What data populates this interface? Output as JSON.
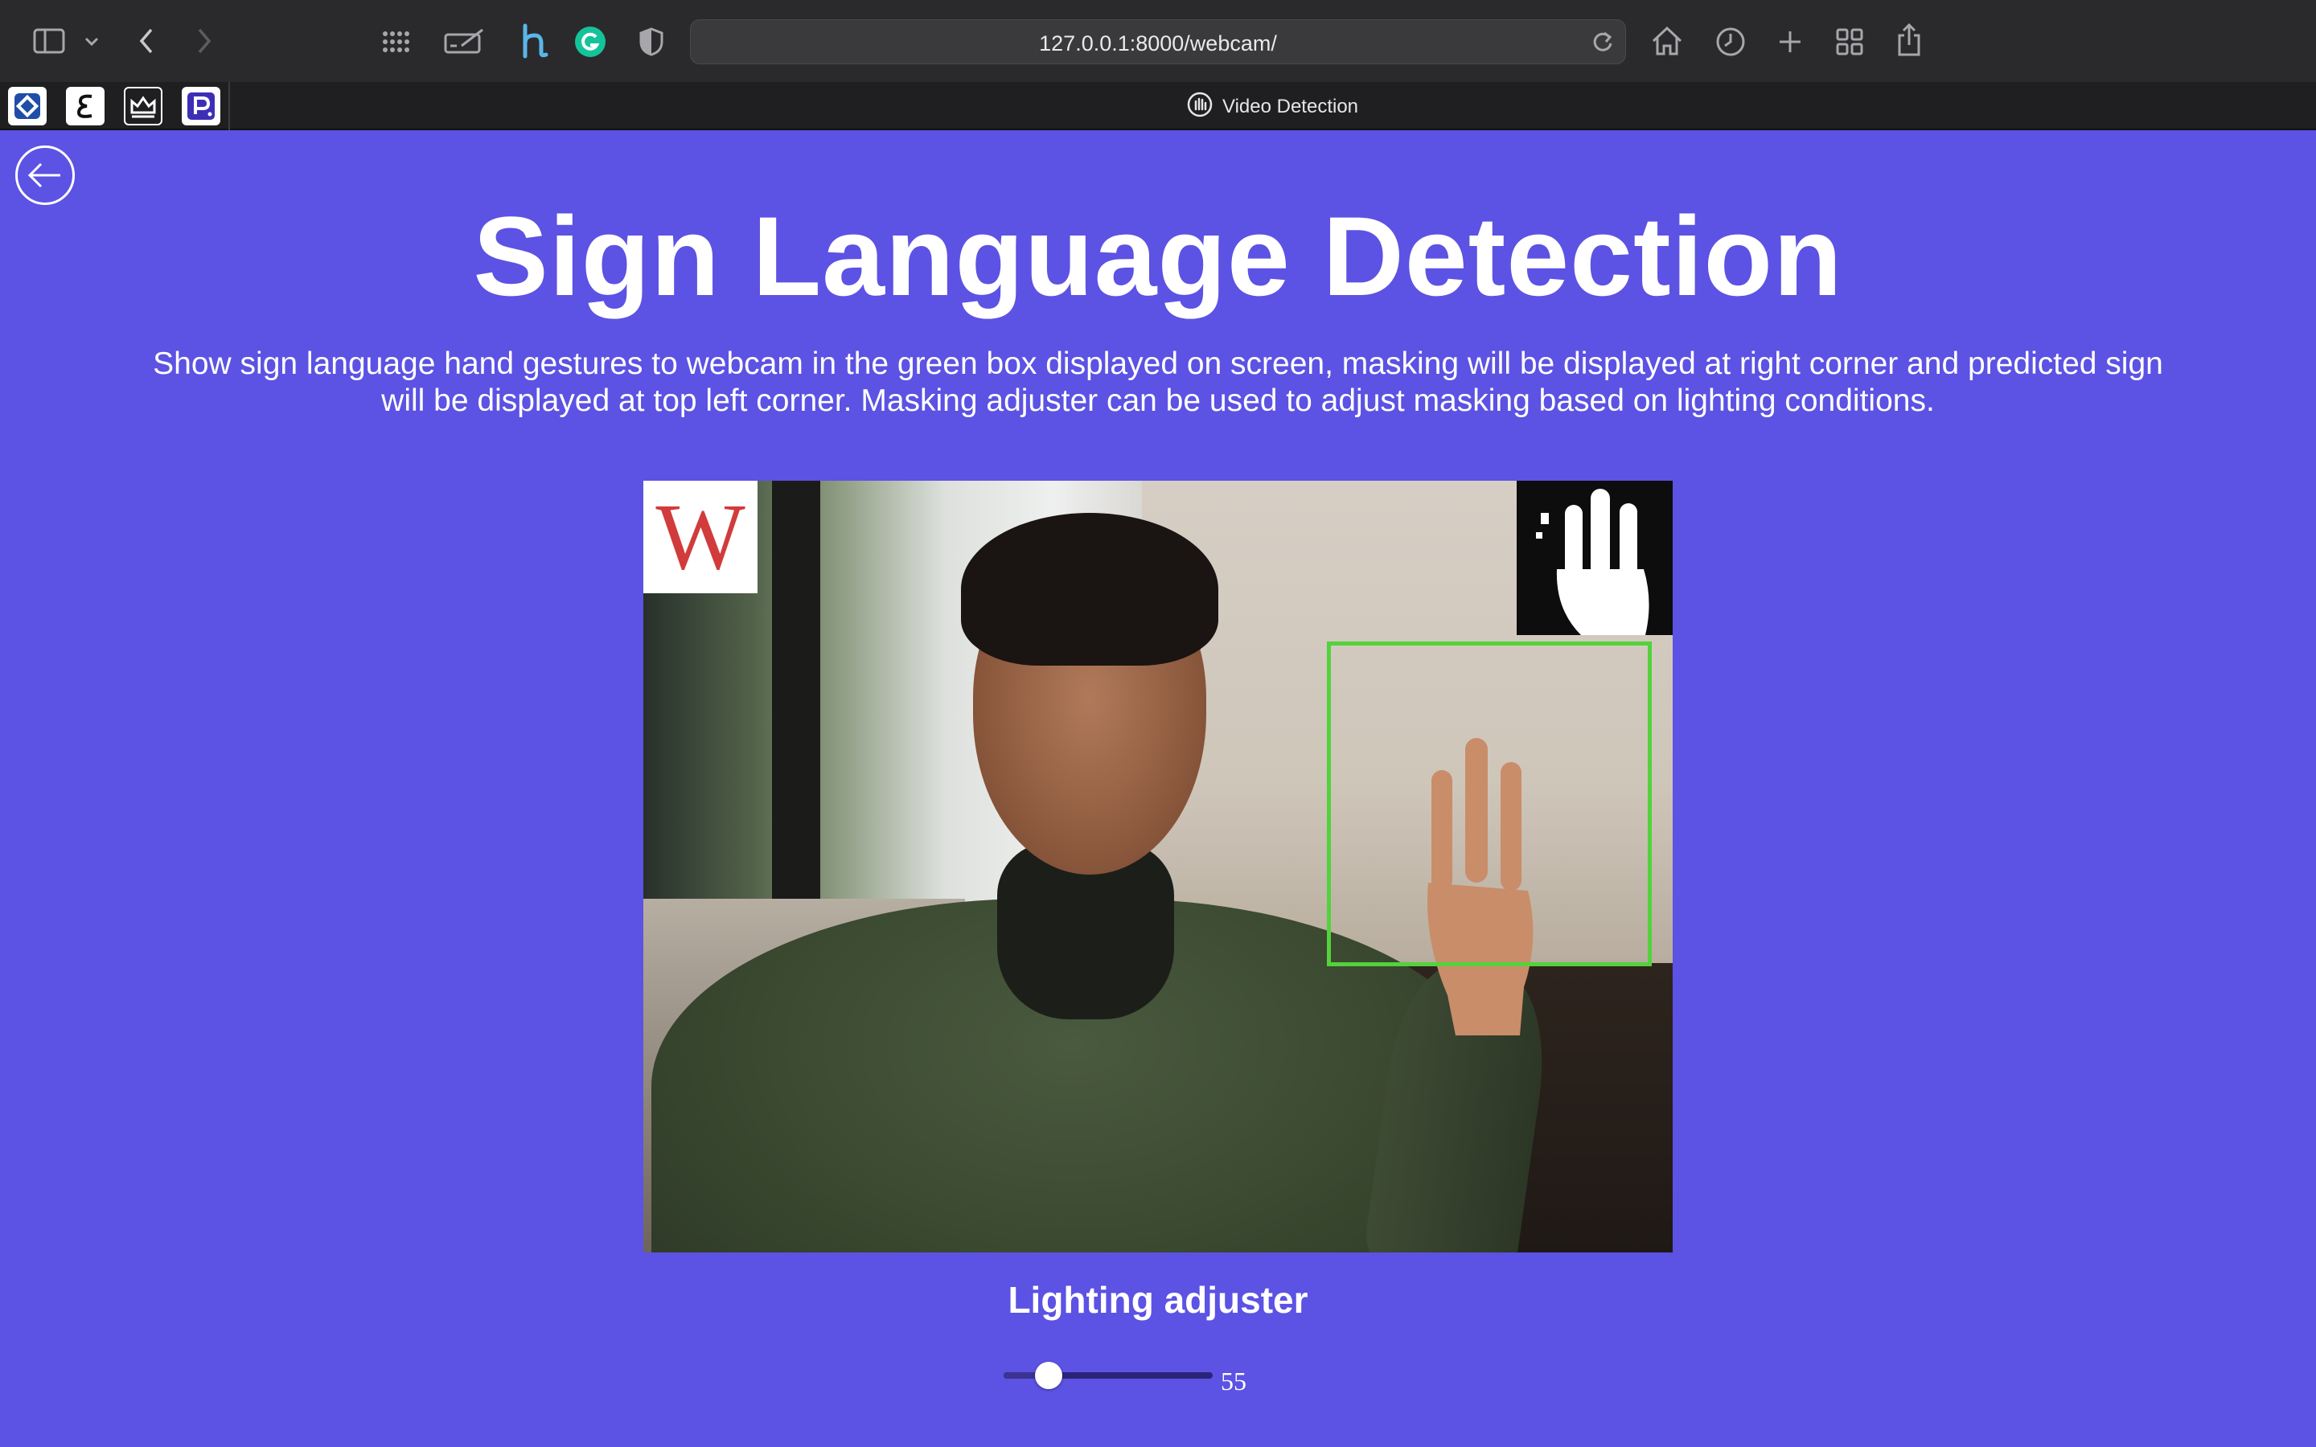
{
  "browser": {
    "url": "127.0.0.1:8000/webcam/",
    "tab_title": "Video Detection",
    "extensions": [
      "hypothesis-icon",
      "grammarly-icon",
      "privacy-shield-icon"
    ],
    "bookmarks": [
      "bookmark-diamond-icon",
      "bookmark-e-icon",
      "bookmark-crown-icon",
      "bookmark-p-icon"
    ]
  },
  "page": {
    "title": "Sign Language Detection",
    "description": "Show sign language hand gestures to webcam in the green box displayed on screen, masking will be displayed at right corner and predicted sign will be displayed at top left corner. Masking adjuster can be used to adjust masking based on lighting conditions.",
    "predicted_sign": "W",
    "lighting_label": "Lighting adjuster",
    "slider": {
      "value": "55",
      "min": 0,
      "max": 255
    }
  },
  "colors": {
    "page_background": "#5c52e3",
    "detection_box": "#53d23b",
    "prediction_letter": "#d23b3b"
  }
}
